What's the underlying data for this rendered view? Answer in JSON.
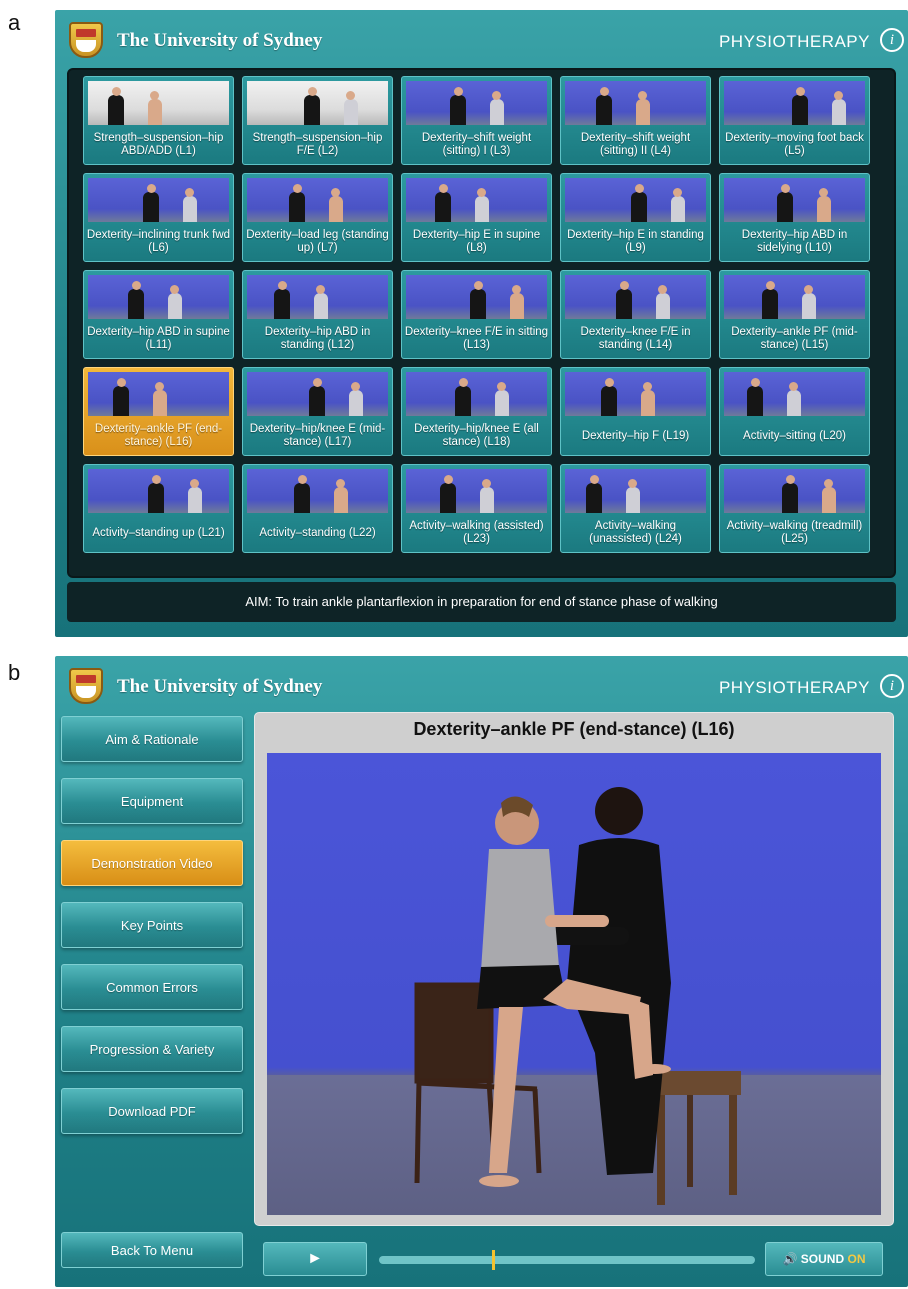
{
  "panel_labels": {
    "a": "a",
    "b": "b"
  },
  "header": {
    "university": "The University of Sydney",
    "department": "PHYSIOTHERAPY",
    "info_glyph": "i"
  },
  "colors": {
    "teal": "#1f8087",
    "orange_selected": "#d9901a",
    "grid_background": "#0e2326",
    "video_blue": "#4b55d8"
  },
  "menu_grid": {
    "tiles": [
      {
        "label": "Strength–suspension–hip ABD/ADD (L1)",
        "selected": false
      },
      {
        "label": "Strength–suspension–hip F/E (L2)",
        "selected": false
      },
      {
        "label": "Dexterity–shift weight (sitting) I (L3)",
        "selected": false
      },
      {
        "label": "Dexterity–shift weight (sitting) II (L4)",
        "selected": false
      },
      {
        "label": "Dexterity–moving foot back (L5)",
        "selected": false
      },
      {
        "label": "Dexterity–inclining trunk fwd (L6)",
        "selected": false
      },
      {
        "label": "Dexterity–load leg (standing up) (L7)",
        "selected": false
      },
      {
        "label": "Dexterity–hip E in supine (L8)",
        "selected": false
      },
      {
        "label": "Dexterity–hip E in standing (L9)",
        "selected": false
      },
      {
        "label": "Dexterity–hip ABD in sidelying (L10)",
        "selected": false
      },
      {
        "label": "Dexterity–hip ABD in supine (L11)",
        "selected": false
      },
      {
        "label": "Dexterity–hip ABD in standing (L12)",
        "selected": false
      },
      {
        "label": "Dexterity–knee F/E in sitting (L13)",
        "selected": false
      },
      {
        "label": "Dexterity–knee F/E in standing (L14)",
        "selected": false
      },
      {
        "label": "Dexterity–ankle PF (mid-stance) (L15)",
        "selected": false
      },
      {
        "label": "Dexterity–ankle PF (end-stance) (L16)",
        "selected": true
      },
      {
        "label": "Dexterity–hip/knee E (mid-stance) (L17)",
        "selected": false
      },
      {
        "label": "Dexterity–hip/knee E (all stance) (L18)",
        "selected": false
      },
      {
        "label": "Dexterity–hip F (L19)",
        "selected": false
      },
      {
        "label": "Activity–sitting (L20)",
        "selected": false
      },
      {
        "label": "Activity–standing up (L21)",
        "selected": false
      },
      {
        "label": "Activity–standing (L22)",
        "selected": false
      },
      {
        "label": "Activity–walking (assisted) (L23)",
        "selected": false
      },
      {
        "label": "Activity–walking (unassisted) (L24)",
        "selected": false
      },
      {
        "label": "Activity–walking (treadmill) (L25)",
        "selected": false
      }
    ],
    "aim_text": "AIM: To train ankle plantarflexion in preparation for end of stance phase of walking"
  },
  "detail": {
    "menu": [
      {
        "label": "Aim & Rationale",
        "active": false
      },
      {
        "label": "Equipment",
        "active": false
      },
      {
        "label": "Demonstration Video",
        "active": true
      },
      {
        "label": "Key Points",
        "active": false
      },
      {
        "label": "Common Errors",
        "active": false
      },
      {
        "label": "Progression & Variety",
        "active": false
      },
      {
        "label": "Download PDF",
        "active": false
      }
    ],
    "back_label": "Back To Menu",
    "video_title": "Dexterity–ankle PF (end-stance) (L16)",
    "playback_progress": 0.3,
    "play_glyph": "►",
    "sound_label": "SOUND",
    "sound_state": "ON",
    "sound_glyph": "🔊"
  }
}
